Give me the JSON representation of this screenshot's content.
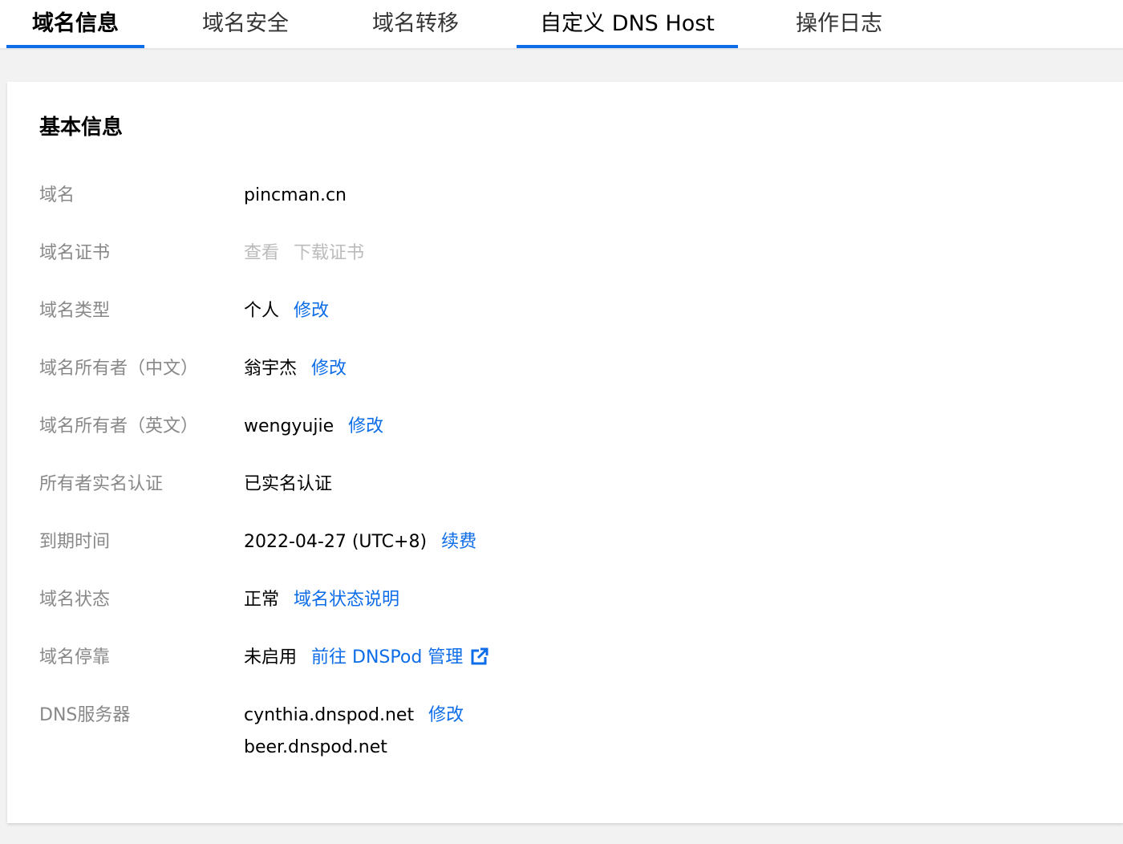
{
  "tabs": [
    {
      "label": "域名信息",
      "active": true
    },
    {
      "label": "域名安全",
      "active": false
    },
    {
      "label": "域名转移",
      "active": false
    },
    {
      "label": "自定义 DNS Host",
      "active": true
    },
    {
      "label": "操作日志",
      "active": false
    }
  ],
  "card": {
    "title": "基本信息",
    "rows": {
      "domain": {
        "label": "域名",
        "value": "pincman.cn"
      },
      "certificate": {
        "label": "域名证书",
        "view": "查看",
        "download": "下载证书"
      },
      "type": {
        "label": "域名类型",
        "value": "个人",
        "action": "修改"
      },
      "owner_cn": {
        "label": "域名所有者（中文）",
        "value": "翁宇杰",
        "action": "修改"
      },
      "owner_en": {
        "label": "域名所有者（英文）",
        "value": "wengyujie",
        "action": "修改"
      },
      "verification": {
        "label": "所有者实名认证",
        "value": "已实名认证"
      },
      "expiry": {
        "label": "到期时间",
        "value": "2022-04-27 (UTC+8)",
        "action": "续费"
      },
      "status": {
        "label": "域名状态",
        "value": "正常",
        "action": "域名状态说明"
      },
      "parking": {
        "label": "域名停靠",
        "value": "未启用",
        "action": "前往 DNSPod 管理"
      },
      "dns": {
        "label": "DNS服务器",
        "server1": "cynthia.dnspod.net",
        "server2": "beer.dnspod.net",
        "action": "修改"
      }
    }
  },
  "colors": {
    "accent": "#0d6de8",
    "label": "#888888",
    "disabled": "#bbbbbb"
  },
  "icons": {
    "external_link": "external-link-icon"
  }
}
